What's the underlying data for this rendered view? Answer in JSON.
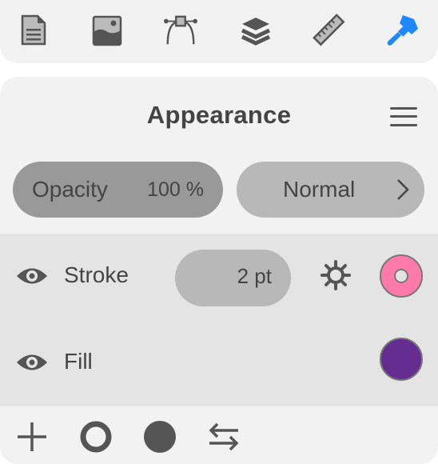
{
  "toolbar": {
    "items": [
      {
        "name": "document",
        "icon": "document-icon",
        "active": false
      },
      {
        "name": "image",
        "icon": "image-icon",
        "active": false
      },
      {
        "name": "path",
        "icon": "bezier-path-icon",
        "active": false
      },
      {
        "name": "layers",
        "icon": "layers-icon",
        "active": false
      },
      {
        "name": "measure",
        "icon": "ruler-icon",
        "active": false
      },
      {
        "name": "appearance",
        "icon": "paintbrush-icon",
        "active": true
      }
    ],
    "active_color": "#1e88ff",
    "icon_color": "#555555"
  },
  "panel": {
    "title": "Appearance",
    "menu_icon": "hamburger-menu-icon",
    "opacity": {
      "label": "Opacity",
      "value": "100 %"
    },
    "blend_mode": {
      "value": "Normal",
      "icon": "chevron-right-icon"
    },
    "layers": [
      {
        "label": "Stroke",
        "visible": true,
        "width": "2 pt",
        "color": "#ff7aa8",
        "has_settings": true
      },
      {
        "label": "Fill",
        "visible": true,
        "color": "#662d91"
      }
    ],
    "bottom_actions": [
      {
        "name": "add",
        "icon": "plus-icon"
      },
      {
        "name": "add-stroke",
        "icon": "ring-icon"
      },
      {
        "name": "add-fill",
        "icon": "filled-circle-icon"
      },
      {
        "name": "swap",
        "icon": "swap-arrows-icon"
      }
    ]
  }
}
